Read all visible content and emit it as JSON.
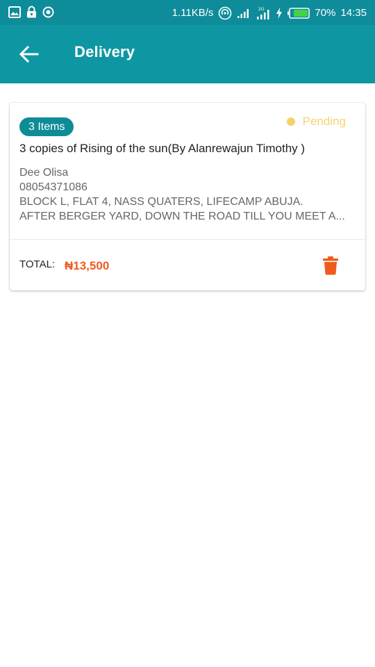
{
  "status_bar": {
    "speed": "1.11KB/s",
    "battery": "70%",
    "time": "14:35",
    "icons": [
      "image-icon",
      "lock-icon",
      "circle-icon",
      "hotspot-icon",
      "signal-icon",
      "signal-2-icon",
      "charging-icon",
      "battery-icon"
    ]
  },
  "app_bar": {
    "title": "Delivery",
    "back_icon": "arrow-left-icon",
    "background": "#0E97A3"
  },
  "order": {
    "items_badge": "3 Items",
    "status": "Pending",
    "status_color": "#F6D474",
    "title": "3 copies of Rising of the sun(By Alanrewajun Timothy )",
    "name": "Dee Olisa",
    "phone": "08054371086",
    "address_line1": "BLOCK L, FLAT 4, NASS QUATERS, LIFECAMP ABUJA.",
    "address_line2": "AFTER BERGER YARD, DOWN THE ROAD TILL YOU MEET A...",
    "total_label": "TOTAL:",
    "total_value": "₦13,500",
    "total_color": "#EF5B1E",
    "delete_icon": "trash-icon"
  }
}
